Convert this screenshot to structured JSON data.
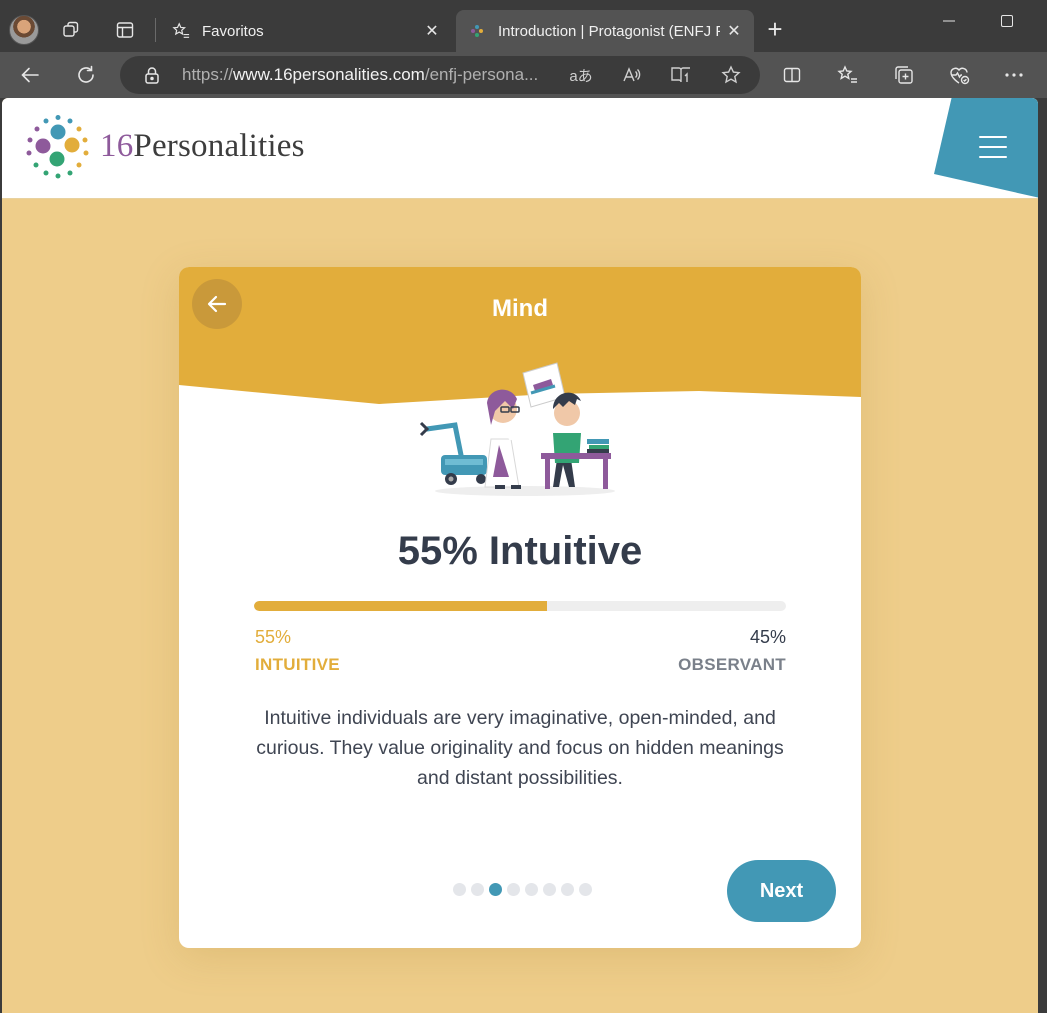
{
  "browser": {
    "tabs": [
      {
        "title": "Favoritos",
        "icon": "star-list-icon",
        "active": false
      },
      {
        "title": "Introduction | Protagonist (ENFJ Personality)",
        "icon": "16personalities-favicon",
        "active": true
      }
    ],
    "url": {
      "scheme": "https://",
      "host": "www.16personalities.com",
      "path": "/enfj-persona..."
    }
  },
  "site": {
    "logo_number": "16",
    "logo_word": "Personalities",
    "colors": {
      "purple": "#8e5a9b",
      "teal": "#4298b5",
      "yellow": "#e2ad3b",
      "green": "#33a474"
    }
  },
  "card": {
    "title": "Mind",
    "result_heading": "55% Intuitive",
    "progress": {
      "value_percent": 55,
      "color": "#e2ad3b"
    },
    "left": {
      "percent": "55%",
      "label": "INTUITIVE"
    },
    "right": {
      "percent": "45%",
      "label": "OBSERVANT"
    },
    "description": "Intuitive individuals are very imaginative, open-minded, and curious. They value originality and focus on hidden meanings and distant possibilities.",
    "pagination": {
      "total": 8,
      "active_index": 2
    },
    "next_label": "Next"
  }
}
